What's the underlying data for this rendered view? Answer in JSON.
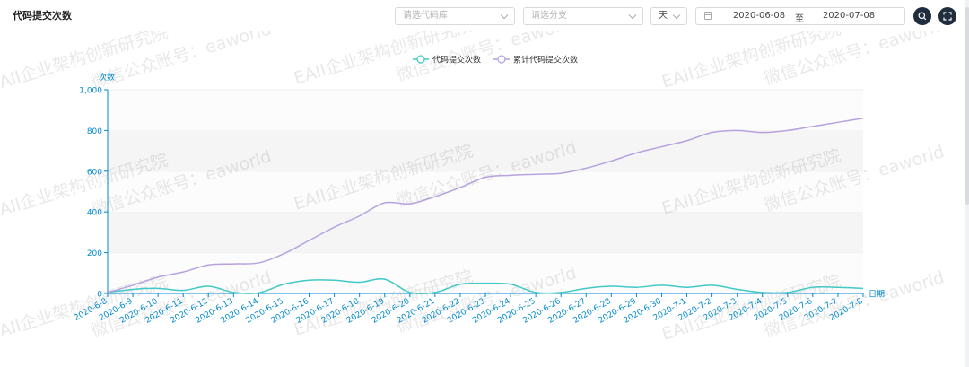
{
  "header": {
    "title": "代码提交次数",
    "repo_select_placeholder": "请选代码库",
    "branch_select_placeholder": "请选分支",
    "granularity": "天",
    "date_start": "2020-06-08",
    "date_separator": "至",
    "date_end": "2020-07-08"
  },
  "watermark": {
    "line1": "EAII企业架构创新研究院",
    "line2": "微信公众账号：eaworld"
  },
  "colors": {
    "commits": "#40c9c6",
    "cumulative": "#b6a2de",
    "axis": "#008acd",
    "grid_band": "#f5f5f5"
  },
  "chart_data": {
    "type": "line",
    "ylabel": "次数",
    "xlabel": "日期",
    "ylim": [
      0,
      1000
    ],
    "yticks": [
      "0",
      "200",
      "400",
      "600",
      "800",
      "1,000"
    ],
    "categories": [
      "2020-6-8",
      "2020-6-9",
      "2020-6-10",
      "2020-6-11",
      "2020-6-12",
      "2020-6-13",
      "2020-6-14",
      "2020-6-15",
      "2020-6-16",
      "2020-6-17",
      "2020-6-18",
      "2020-6-19",
      "2020-6-20",
      "2020-6-21",
      "2020-6-22",
      "2020-6-23",
      "2020-6-24",
      "2020-6-25",
      "2020-6-26",
      "2020-6-27",
      "2020-6-28",
      "2020-6-29",
      "2020-6-30",
      "2020-7-1",
      "2020-7-2",
      "2020-7-3",
      "2020-7-4",
      "2020-7-5",
      "2020-7-6",
      "2020-7-7",
      "2020-7-8"
    ],
    "series": [
      {
        "name": "代码提交次数",
        "values": [
          5,
          20,
          25,
          15,
          35,
          5,
          3,
          45,
          65,
          65,
          55,
          70,
          5,
          5,
          45,
          50,
          45,
          5,
          5,
          25,
          35,
          30,
          40,
          30,
          40,
          20,
          5,
          5,
          30,
          30,
          25
        ]
      },
      {
        "name": "累计代码提交次数",
        "values": [
          5,
          40,
          80,
          105,
          140,
          145,
          150,
          195,
          260,
          325,
          380,
          445,
          440,
          475,
          520,
          570,
          580,
          585,
          590,
          615,
          650,
          690,
          720,
          750,
          790,
          800,
          790,
          800,
          820,
          840,
          860
        ]
      }
    ],
    "legend_position": "top-center",
    "grid": "horizontal-bands"
  }
}
